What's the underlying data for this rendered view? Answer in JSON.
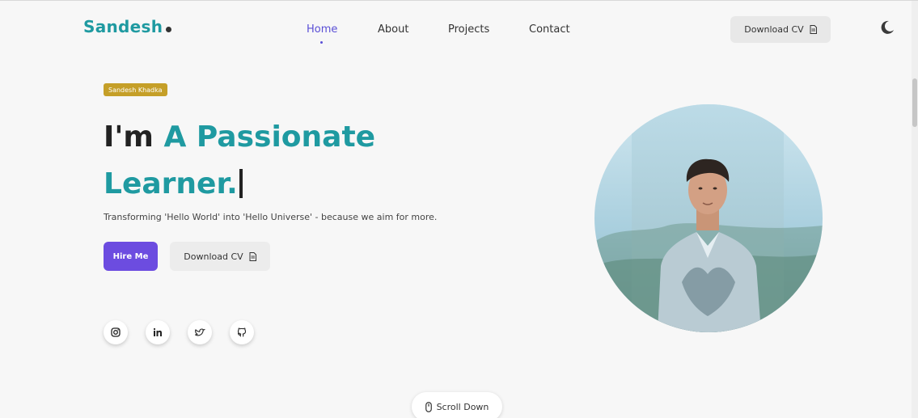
{
  "header": {
    "logo": "Sandesh",
    "nav": [
      {
        "label": "Home",
        "active": true
      },
      {
        "label": "About",
        "active": false
      },
      {
        "label": "Projects",
        "active": false
      },
      {
        "label": "Contact",
        "active": false
      }
    ],
    "download_cv": "Download CV",
    "theme_icon": "moon-icon"
  },
  "hero": {
    "badge": "Sandesh Khadka",
    "headline_prefix": "I'm",
    "headline_highlight_1": "A Passionate",
    "headline_highlight_2": "Learner.",
    "tagline": "Transforming 'Hello World' into 'Hello Universe' - because we aim for more.",
    "hire_button": "Hire Me",
    "download_cv": "Download CV",
    "socials": [
      "instagram-icon",
      "linkedin-icon",
      "twitter-icon",
      "github-icon"
    ]
  },
  "scroll": {
    "label": "Scroll Down",
    "icon": "mouse-icon"
  },
  "colors": {
    "brand_teal": "#1f9aa1",
    "accent_purple": "#6c4ce0",
    "badge_gold": "#c59f28",
    "background": "#f7f7f7"
  }
}
